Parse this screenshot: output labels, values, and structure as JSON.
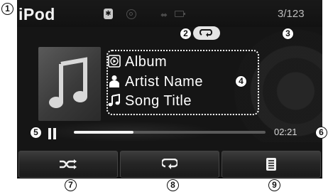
{
  "app": {
    "title": "iPod"
  },
  "status": {
    "bluetooth_icon": "bluetooth-icon",
    "usb_icon": "usb-icon",
    "battery_icon": "battery-icon"
  },
  "playback": {
    "track_count": "3/123",
    "repeat_icon": "repeat-icon",
    "album": "Album",
    "artist": "Artist Name",
    "song": "Song Title",
    "progress": 0.31,
    "elapsed": "02:21",
    "state": "paused"
  },
  "buttons": [
    {
      "icon": "shuffle-icon"
    },
    {
      "icon": "repeat-icon"
    },
    {
      "icon": "list-icon"
    }
  ],
  "callouts": [
    "1",
    "2",
    "3",
    "4",
    "5",
    "6",
    "7",
    "8",
    "9"
  ],
  "colors": {
    "screen_bg": "#151515",
    "text": "#ffffff",
    "accent": "#e4e4e4"
  }
}
